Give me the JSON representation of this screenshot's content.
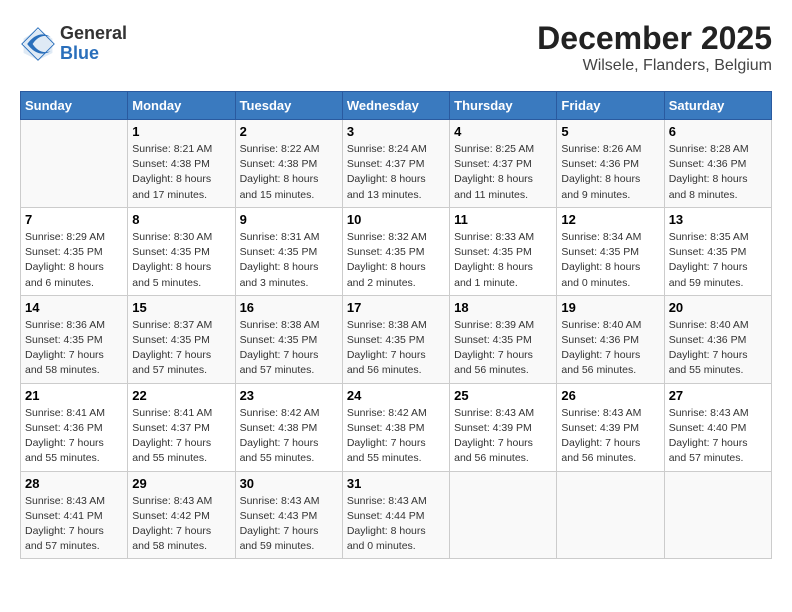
{
  "logo": {
    "text_general": "General",
    "text_blue": "Blue"
  },
  "title": "December 2025",
  "subtitle": "Wilsele, Flanders, Belgium",
  "days_of_week": [
    "Sunday",
    "Monday",
    "Tuesday",
    "Wednesday",
    "Thursday",
    "Friday",
    "Saturday"
  ],
  "weeks": [
    [
      {
        "day": "",
        "info": ""
      },
      {
        "day": "1",
        "info": "Sunrise: 8:21 AM\nSunset: 4:38 PM\nDaylight: 8 hours\nand 17 minutes."
      },
      {
        "day": "2",
        "info": "Sunrise: 8:22 AM\nSunset: 4:38 PM\nDaylight: 8 hours\nand 15 minutes."
      },
      {
        "day": "3",
        "info": "Sunrise: 8:24 AM\nSunset: 4:37 PM\nDaylight: 8 hours\nand 13 minutes."
      },
      {
        "day": "4",
        "info": "Sunrise: 8:25 AM\nSunset: 4:37 PM\nDaylight: 8 hours\nand 11 minutes."
      },
      {
        "day": "5",
        "info": "Sunrise: 8:26 AM\nSunset: 4:36 PM\nDaylight: 8 hours\nand 9 minutes."
      },
      {
        "day": "6",
        "info": "Sunrise: 8:28 AM\nSunset: 4:36 PM\nDaylight: 8 hours\nand 8 minutes."
      }
    ],
    [
      {
        "day": "7",
        "info": "Sunrise: 8:29 AM\nSunset: 4:35 PM\nDaylight: 8 hours\nand 6 minutes."
      },
      {
        "day": "8",
        "info": "Sunrise: 8:30 AM\nSunset: 4:35 PM\nDaylight: 8 hours\nand 5 minutes."
      },
      {
        "day": "9",
        "info": "Sunrise: 8:31 AM\nSunset: 4:35 PM\nDaylight: 8 hours\nand 3 minutes."
      },
      {
        "day": "10",
        "info": "Sunrise: 8:32 AM\nSunset: 4:35 PM\nDaylight: 8 hours\nand 2 minutes."
      },
      {
        "day": "11",
        "info": "Sunrise: 8:33 AM\nSunset: 4:35 PM\nDaylight: 8 hours\nand 1 minute."
      },
      {
        "day": "12",
        "info": "Sunrise: 8:34 AM\nSunset: 4:35 PM\nDaylight: 8 hours\nand 0 minutes."
      },
      {
        "day": "13",
        "info": "Sunrise: 8:35 AM\nSunset: 4:35 PM\nDaylight: 7 hours\nand 59 minutes."
      }
    ],
    [
      {
        "day": "14",
        "info": "Sunrise: 8:36 AM\nSunset: 4:35 PM\nDaylight: 7 hours\nand 58 minutes."
      },
      {
        "day": "15",
        "info": "Sunrise: 8:37 AM\nSunset: 4:35 PM\nDaylight: 7 hours\nand 57 minutes."
      },
      {
        "day": "16",
        "info": "Sunrise: 8:38 AM\nSunset: 4:35 PM\nDaylight: 7 hours\nand 57 minutes."
      },
      {
        "day": "17",
        "info": "Sunrise: 8:38 AM\nSunset: 4:35 PM\nDaylight: 7 hours\nand 56 minutes."
      },
      {
        "day": "18",
        "info": "Sunrise: 8:39 AM\nSunset: 4:35 PM\nDaylight: 7 hours\nand 56 minutes."
      },
      {
        "day": "19",
        "info": "Sunrise: 8:40 AM\nSunset: 4:36 PM\nDaylight: 7 hours\nand 56 minutes."
      },
      {
        "day": "20",
        "info": "Sunrise: 8:40 AM\nSunset: 4:36 PM\nDaylight: 7 hours\nand 55 minutes."
      }
    ],
    [
      {
        "day": "21",
        "info": "Sunrise: 8:41 AM\nSunset: 4:36 PM\nDaylight: 7 hours\nand 55 minutes."
      },
      {
        "day": "22",
        "info": "Sunrise: 8:41 AM\nSunset: 4:37 PM\nDaylight: 7 hours\nand 55 minutes."
      },
      {
        "day": "23",
        "info": "Sunrise: 8:42 AM\nSunset: 4:38 PM\nDaylight: 7 hours\nand 55 minutes."
      },
      {
        "day": "24",
        "info": "Sunrise: 8:42 AM\nSunset: 4:38 PM\nDaylight: 7 hours\nand 55 minutes."
      },
      {
        "day": "25",
        "info": "Sunrise: 8:43 AM\nSunset: 4:39 PM\nDaylight: 7 hours\nand 56 minutes."
      },
      {
        "day": "26",
        "info": "Sunrise: 8:43 AM\nSunset: 4:39 PM\nDaylight: 7 hours\nand 56 minutes."
      },
      {
        "day": "27",
        "info": "Sunrise: 8:43 AM\nSunset: 4:40 PM\nDaylight: 7 hours\nand 57 minutes."
      }
    ],
    [
      {
        "day": "28",
        "info": "Sunrise: 8:43 AM\nSunset: 4:41 PM\nDaylight: 7 hours\nand 57 minutes."
      },
      {
        "day": "29",
        "info": "Sunrise: 8:43 AM\nSunset: 4:42 PM\nDaylight: 7 hours\nand 58 minutes."
      },
      {
        "day": "30",
        "info": "Sunrise: 8:43 AM\nSunset: 4:43 PM\nDaylight: 7 hours\nand 59 minutes."
      },
      {
        "day": "31",
        "info": "Sunrise: 8:43 AM\nSunset: 4:44 PM\nDaylight: 8 hours\nand 0 minutes."
      },
      {
        "day": "",
        "info": ""
      },
      {
        "day": "",
        "info": ""
      },
      {
        "day": "",
        "info": ""
      }
    ]
  ]
}
